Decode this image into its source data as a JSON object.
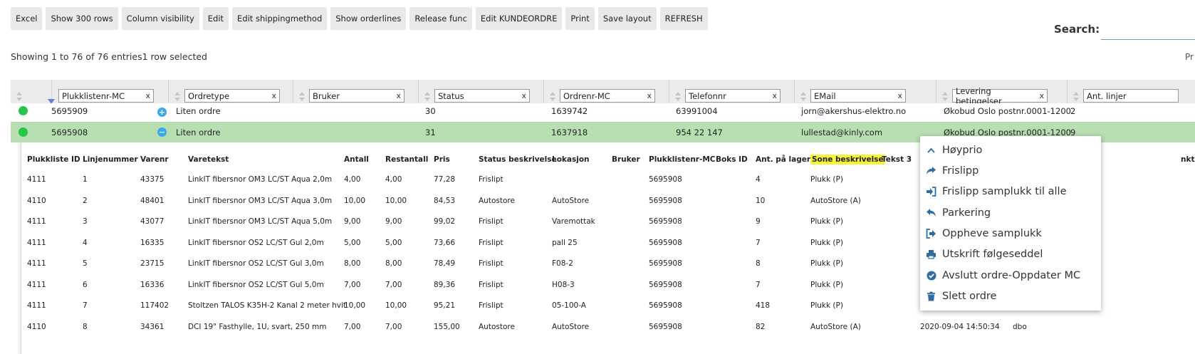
{
  "toolbar": {
    "buttons": [
      "Excel",
      "Show 300 rows",
      "Column visibility",
      "Edit",
      "Edit shippingmethod",
      "Show orderlines",
      "Release func",
      "Edit KUNDEORDRE",
      "Print",
      "Save layout",
      "REFRESH"
    ]
  },
  "search": {
    "label": "Search:",
    "value": ""
  },
  "info": {
    "showing": "Showing 1 to 76 of 76 entries1 row selected",
    "right_partial": "Pr"
  },
  "grid": {
    "filters": [
      "Plukklistenr-MC",
      "Ordretype",
      "Bruker",
      "Status",
      "Ordrenr-MC",
      "Telefonnr",
      "EMail",
      "Levering betingelser",
      "Ant. linjer"
    ],
    "rows": [
      {
        "plukkliste": "5695909",
        "ordretype": "Liten ordre",
        "bruker": "",
        "status": "30",
        "ordrenr": "1639742",
        "telefon": "63991004",
        "email": "jorn@akershus-elektro.no",
        "levering": "Økobud Oslo postnr.0001-1200",
        "linjer": "2",
        "toggle": "+"
      },
      {
        "plukkliste": "5695908",
        "ordretype": "Liten ordre",
        "bruker": "",
        "status": "31",
        "ordrenr": "1637918",
        "telefon": "954 22 147",
        "email": "lullestad@kinly.com",
        "levering": "Økobud Oslo postnr.0001-1200",
        "linjer": "9",
        "toggle": "−"
      }
    ]
  },
  "sub": {
    "headers": [
      "Plukkliste ID",
      "Linjenummer",
      "Varenr",
      "Varetekst",
      "Antall",
      "Restantall",
      "Pris",
      "Status beskrivelse",
      "Lokasjon",
      "Bruker",
      "Plukklistenr-MC",
      "Boks ID",
      "Ant. på lager",
      "Sone beskrivelse",
      "Tekst 3",
      "nkt"
    ],
    "rows": [
      [
        "4111",
        "1",
        "43375",
        "LinkIT fibersnor OM3 LC/ST Aqua 2,0m",
        "4,00",
        "4,00",
        "77,28",
        "Frislipt",
        "",
        "",
        "5695908",
        "",
        "4",
        "Plukk (P)",
        "",
        ""
      ],
      [
        "4110",
        "2",
        "48401",
        "LinkIT fibersnor OM3 LC/ST Aqua 3,0m",
        "10,00",
        "10,00",
        "84,53",
        "Autostore",
        "AutoStore",
        "",
        "5695908",
        "",
        "10",
        "AutoStore (A)",
        "",
        ""
      ],
      [
        "4111",
        "3",
        "43077",
        "LinkIT fibersnor OM3 LC/ST Aqua 5,0m",
        "9,00",
        "9,00",
        "99,02",
        "Frislipt",
        "Varemottak",
        "",
        "5695908",
        "",
        "9",
        "Plukk (P)",
        "",
        ""
      ],
      [
        "4111",
        "4",
        "16335",
        "LinkIT fibersnor OS2 LC/ST Gul 2,0m",
        "5,00",
        "5,00",
        "73,66",
        "Frislipt",
        "pall 25",
        "",
        "5695908",
        "",
        "7",
        "Plukk (P)",
        "",
        ""
      ],
      [
        "4111",
        "5",
        "23715",
        "LinkIT fibersnor OS2 LC/ST Gul 3,0m",
        "8,00",
        "8,00",
        "78,49",
        "Frislipt",
        "F08-2",
        "",
        "5695908",
        "",
        "8",
        "Plukk (P)",
        "",
        ""
      ],
      [
        "4111",
        "6",
        "16336",
        "LinkIT fibersnor OS2 LC/ST Gul 5,0m",
        "7,00",
        "7,00",
        "89,36",
        "Frislipt",
        "H08-3",
        "",
        "5695908",
        "",
        "7",
        "Plukk (P)",
        "",
        ""
      ],
      [
        "4111",
        "7",
        "117402",
        "Stoltzen TALOS K35H-2 Kanal 2 meter hvit",
        "10,00",
        "10,00",
        "95,21",
        "Frislipt",
        "05-100-A",
        "",
        "5695908",
        "",
        "418",
        "Plukk (P)",
        "",
        ""
      ],
      [
        "4110",
        "8",
        "34361",
        "DCI 19\" Fasthylle, 1U, svart, 250 mm",
        "7,00",
        "7,00",
        "155,00",
        "Autostore",
        "AutoStore",
        "",
        "5695908",
        "",
        "82",
        "AutoStore (A)",
        "2020-09-04 14:50:34",
        "dbo"
      ]
    ]
  },
  "context_menu": {
    "items": [
      {
        "label": "Høyprio",
        "icon": "chevron-up-icon"
      },
      {
        "label": "Frislipp",
        "icon": "share-arrow-icon"
      },
      {
        "label": "Frislipp samplukk til alle",
        "icon": "sign-in-icon"
      },
      {
        "label": "Parkering",
        "icon": "reply-arrow-icon"
      },
      {
        "label": "Oppheve samplukk",
        "icon": "sign-out-icon"
      },
      {
        "label": "Utskrift følgeseddel",
        "icon": "printer-icon"
      },
      {
        "label": "Avslutt ordre-Oppdater MC",
        "icon": "check-circle-icon"
      },
      {
        "label": "Slett ordre",
        "icon": "trash-icon"
      }
    ],
    "icon_color": "#2d6da4"
  }
}
